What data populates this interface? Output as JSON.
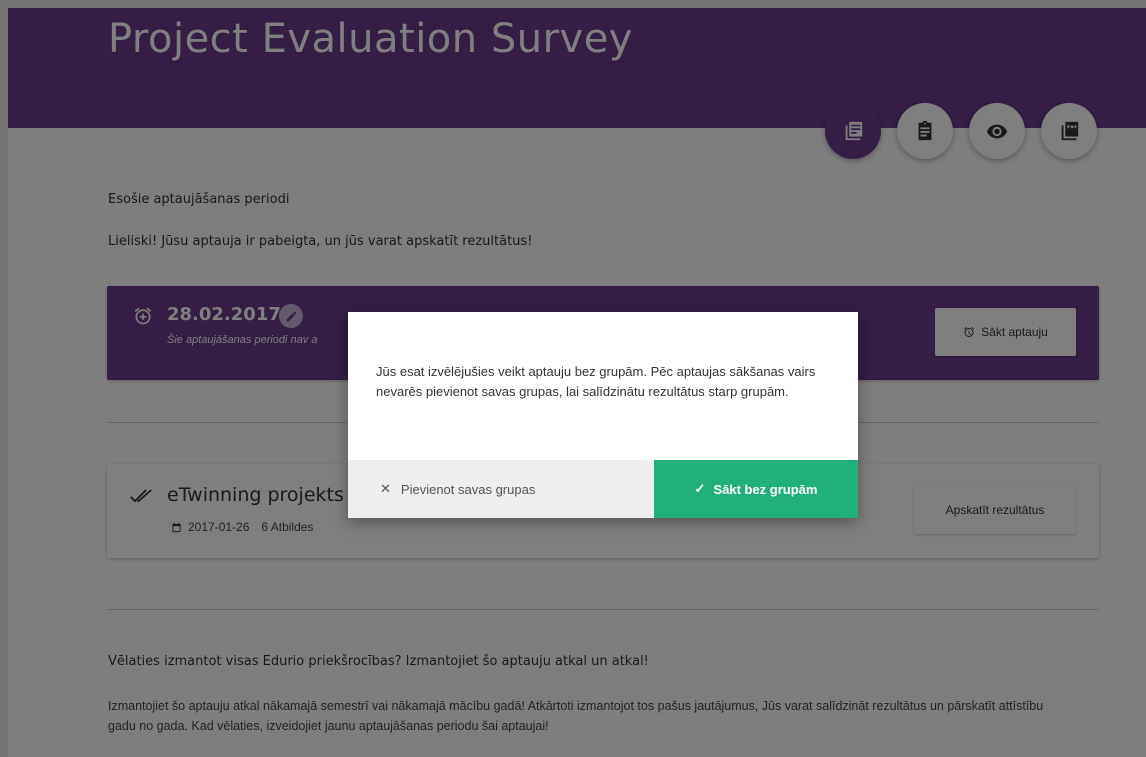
{
  "header": {
    "title": "Project Evaluation Survey"
  },
  "fabs": [
    {
      "icon": "list-icon",
      "active": true
    },
    {
      "icon": "clipboard-icon",
      "active": false
    },
    {
      "icon": "eye-icon",
      "active": false
    },
    {
      "icon": "pdf-icon",
      "active": false
    }
  ],
  "periods_section": {
    "heading": "Esošie aptaujāšanas periodi",
    "status": "Lieliski! Jūsu aptauja ir pabeigta, un jūs varat apskatīt rezultātus!"
  },
  "period_card": {
    "date": "28.02.2017",
    "note": "Šie aptaujāšanas periodi nav a",
    "start_button": "Sākt aptauju"
  },
  "survey_card": {
    "title": "eTwinning projekts",
    "date": "2017-01-26",
    "responses": "6 Atbildes",
    "results_button": "Apskatīt rezultātus"
  },
  "bottom": {
    "heading": "Vēlaties izmantot visas Edurio priekšrocības? Izmantojiet šo aptauju atkal un atkal!",
    "text": "Izmantojiet šo aptauju atkal nākamajā semestrī vai nākamajā mācību gadā! Atkārtoti izmantojot tos pašus jautājumus, Jūs varat salīdzināt rezultātus un pārskatīt attīstību gadu no gada. Kad vēlaties, izveidojiet jaunu aptaujāšanas periodu šai aptaujai!"
  },
  "dialog": {
    "message": "Jūs esat izvēlējušies veikt aptauju bez grupām. Pēc aptaujas sākšanas vairs nevarēs pievienot savas grupas, lai salīdzinātu rezultātus starp grupām.",
    "secondary_button": "Pievienot savas grupas",
    "primary_button": "Sākt bez grupām"
  },
  "colors": {
    "brand": "#6a3a8c",
    "confirm": "#21b07a"
  }
}
